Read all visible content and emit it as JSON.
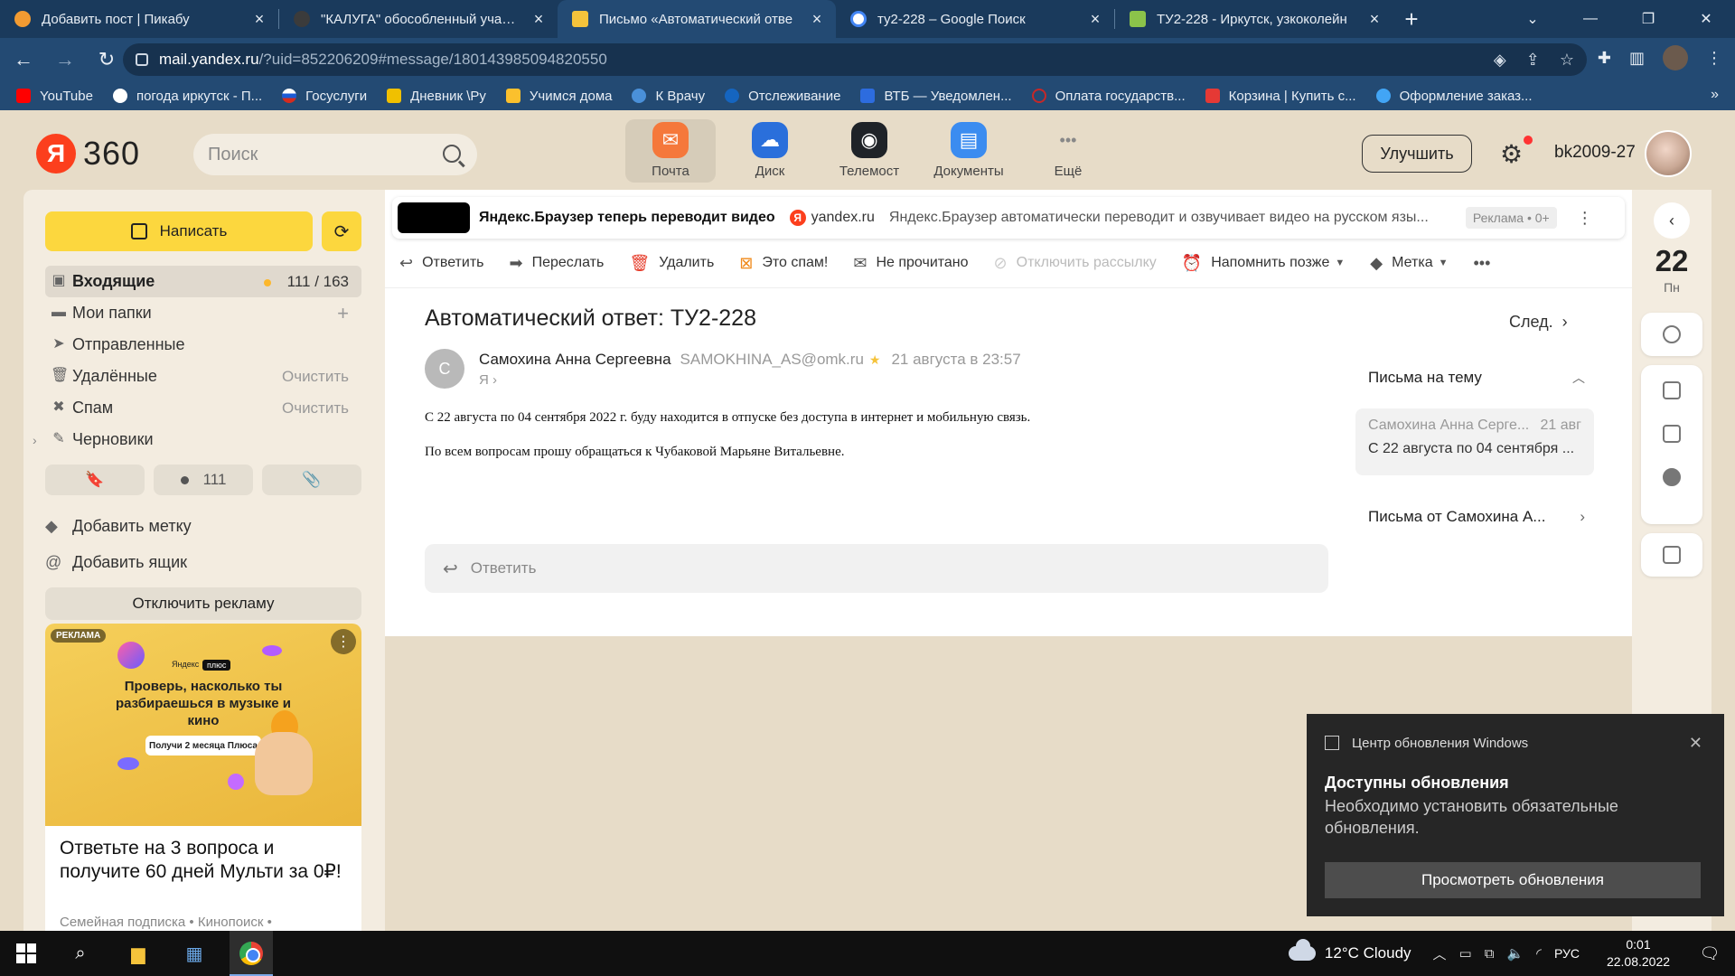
{
  "browser": {
    "tabs": [
      {
        "title": "Добавить пост | Пикабу",
        "fav_color": "#f29b32"
      },
      {
        "title": "\"КАЛУГА\" обособленный участо",
        "fav_color": "#3b3b3b"
      },
      {
        "title": "Письмо «Автоматический отве",
        "fav_color": "#f5c33b"
      },
      {
        "title": "ту2-228 – Google Поиск",
        "fav_color": "#ffffff"
      },
      {
        "title": "ТУ2-228 - Иркутск, узкоколейн",
        "fav_color": "#8bc34a"
      }
    ],
    "url_domain": "mail.yandex.ru",
    "url_rest": "/?uid=852206209#message/180143985094820550",
    "bookmarks": [
      {
        "label": "YouTube",
        "color": "#ff0000"
      },
      {
        "label": "погода иркутск - П...",
        "color": "#ffffff"
      },
      {
        "label": "Госуслуги",
        "color": "#d52b1e"
      },
      {
        "label": "Дневник \\Ру",
        "color": "#f0c000"
      },
      {
        "label": "Учимся дома",
        "color": "#fbc02d"
      },
      {
        "label": "К Врачу",
        "color": "#4a90d9"
      },
      {
        "label": "Отслеживание",
        "color": "#1565c0"
      },
      {
        "label": "ВТБ — Уведомлен...",
        "color": "#2d6cdf"
      },
      {
        "label": "Оплата государств...",
        "color": "#c62828"
      },
      {
        "label": "Корзина | Купить с...",
        "color": "#e53935"
      },
      {
        "label": "Оформление заказ...",
        "color": "#42a5f5"
      }
    ]
  },
  "header": {
    "logo_letter": "Я",
    "logo_text": "360",
    "search_placeholder": "Поиск",
    "apps": [
      {
        "label": "Почта",
        "color": "#f5783b",
        "glyph": "✉"
      },
      {
        "label": "Диск",
        "color": "#2a6fdb",
        "glyph": "☁"
      },
      {
        "label": "Телемост",
        "color": "#1f2328",
        "glyph": "◉"
      },
      {
        "label": "Документы",
        "color": "#3b8cf0",
        "glyph": "▤"
      },
      {
        "label": "Ещё",
        "color": "#f3ece0",
        "glyph": "•••"
      }
    ],
    "upgrade_label": "Улучшить",
    "username": "bk2009-27"
  },
  "sidebar": {
    "compose_label": "Написать",
    "folders": [
      {
        "label": "Входящие",
        "count": "111 / 163",
        "icon": "▣"
      },
      {
        "label": "Мои папки",
        "action": "+",
        "icon": "▬"
      },
      {
        "label": "Отправленные",
        "icon": "➤"
      },
      {
        "label": "Удалённые",
        "action": "Очистить",
        "icon": "🗑"
      },
      {
        "label": "Спам",
        "action": "Очистить",
        "icon": "✖"
      },
      {
        "label": "Черновики",
        "icon": "✎",
        "caret": "›"
      }
    ],
    "unread_count": "111",
    "add_label": "Добавить метку",
    "add_mailbox": "Добавить ящик",
    "disable_ads": "Отключить рекламу",
    "ad": {
      "badge": "РЕКЛАМА",
      "brand": "Яндекс",
      "plus": "плюс",
      "headline": "Проверь, насколько ты разбираешься в музыке и кино",
      "pill": "Получи 2 месяца Плюса",
      "title": "Ответьте на 3 вопроса и получите 60 дней Мульти за 0₽!",
      "sub": "Семейная подписка • Кинопоиск •"
    }
  },
  "main": {
    "adbar": {
      "title": "Яндекс.Браузер теперь переводит видео",
      "domain": "yandex.ru",
      "desc": "Яндекс.Браузер автоматически переводит и озвучивает видео на русском язы...",
      "label": "Реклама • 0+"
    },
    "toolbar": {
      "reply": "Ответить",
      "forward": "Переслать",
      "delete": "Удалить",
      "spam": "Это спам!",
      "unread": "Не прочитано",
      "unsubscribe": "Отключить рассылку",
      "remind": "Напомнить позже",
      "label": "Метка"
    },
    "subject": "Автоматический ответ: ТУ2-228",
    "next_label": "След.",
    "sender": {
      "initial": "С",
      "name": "Самохина Анна Сергеевна",
      "email": "SAMOKHINA_AS@omk.ru",
      "date": "21 августа в 23:57",
      "to": "Я"
    },
    "body_line1": "С 22 августа по 04 сентября 2022 г. буду находится в отпуске без доступа в интернет и мобильную связь.",
    "body_line2": "По всем вопросам прошу обращаться к Чубаковой Марьяне Витальевне.",
    "reply_placeholder": "Ответить",
    "thread": {
      "heading": "Письма на тему",
      "item_from": "Самохина Анна Серге...",
      "item_date": "21 авг",
      "item_snippet": "С 22 августа по 04 сентября ...",
      "from_sender": "Письма от Самохина А..."
    }
  },
  "rail": {
    "day": "22",
    "dow": "Пн"
  },
  "toast": {
    "app": "Центр обновления Windows",
    "title": "Доступны обновления",
    "message": "Необходимо установить обязательные обновления.",
    "button": "Просмотреть обновления"
  },
  "taskbar": {
    "weather": "12°C  Cloudy",
    "lang": "РУС",
    "time": "0:01",
    "date": "22.08.2022"
  }
}
